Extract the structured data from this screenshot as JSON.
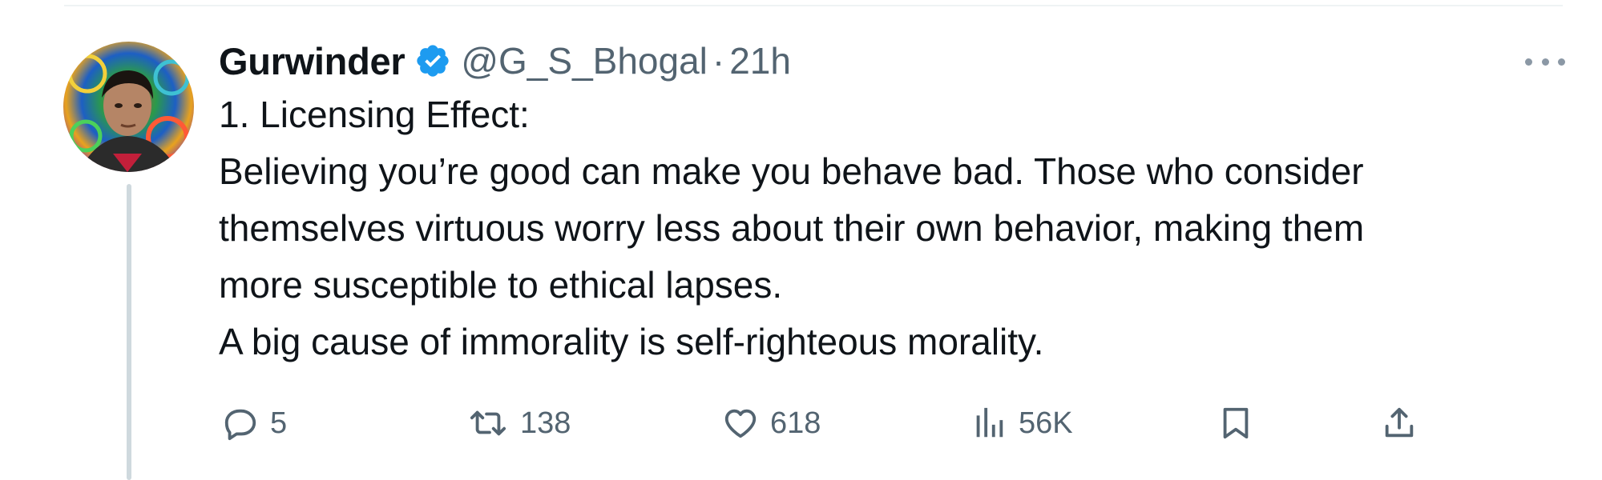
{
  "tweet": {
    "author": {
      "display_name": "Gurwinder",
      "handle": "@G_S_Bhogal",
      "verified": true
    },
    "separator": "·",
    "time": "21h",
    "lines": [
      "1. Licensing Effect:",
      "Believing you’re good can make you behave bad. Those who consider",
      "themselves virtuous worry less about their own behavior, making them",
      "more susceptible to ethical lapses.",
      "A big cause of immorality is self-righteous morality."
    ],
    "actions": {
      "replies": "5",
      "reposts": "138",
      "likes": "618",
      "views": "56K"
    }
  },
  "colors": {
    "text": "#0f1419",
    "secondary": "#536471",
    "verified_blue": "#1d9bf0",
    "divider": "#eff3f4",
    "thread_line": "#cfd9de"
  },
  "icons": {
    "reply": "reply-icon",
    "repost": "repost-icon",
    "like": "heart-icon",
    "views": "views-icon",
    "bookmark": "bookmark-icon",
    "share": "share-icon",
    "more": "more-icon",
    "verified": "verified-badge-icon"
  }
}
